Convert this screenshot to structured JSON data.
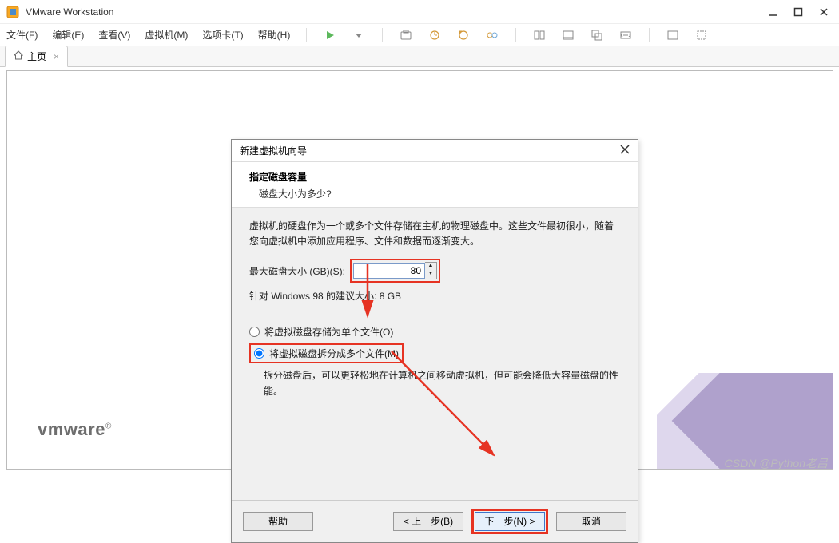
{
  "titlebar": {
    "title": "VMware Workstation"
  },
  "menu": {
    "file": "文件(F)",
    "edit": "编辑(E)",
    "view": "查看(V)",
    "vm": "虚拟机(M)",
    "tabs": "选项卡(T)",
    "help": "帮助(H)"
  },
  "tab": {
    "home": "主页"
  },
  "dialog": {
    "title": "新建虚拟机向导",
    "heading": "指定磁盘容量",
    "subheading": "磁盘大小为多少?",
    "description": "虚拟机的硬盘作为一个或多个文件存储在主机的物理磁盘中。这些文件最初很小，随着您向虚拟机中添加应用程序、文件和数据而逐渐变大。",
    "size_label": "最大磁盘大小 (GB)(S):",
    "size_value": "80",
    "recommended": "针对 Windows 98 的建议大小: 8 GB",
    "radio_single": "将虚拟磁盘存储为单个文件(O)",
    "radio_split": "将虚拟磁盘拆分成多个文件(M)",
    "split_hint": "拆分磁盘后，可以更轻松地在计算机之间移动虚拟机，但可能会降低大容量磁盘的性能。",
    "btn_help": "帮助",
    "btn_back": "< 上一步(B)",
    "btn_next": "下一步(N) >",
    "btn_cancel": "取消"
  },
  "logo": "vmware",
  "watermark": "CSDN @Python老吕",
  "colors": {
    "highlight": "#e63323"
  }
}
